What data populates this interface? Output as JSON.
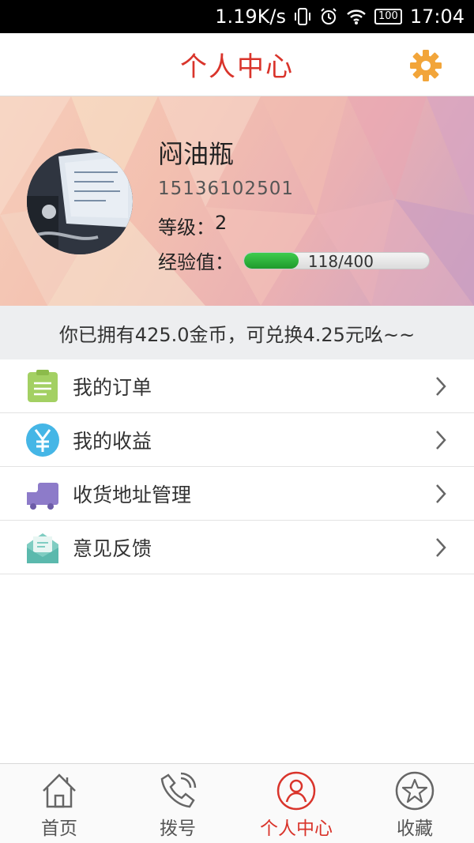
{
  "status_bar": {
    "network_speed": "1.19K/s",
    "battery": "100",
    "time": "17:04"
  },
  "header": {
    "title": "个人中心",
    "settings_icon": "gear-icon"
  },
  "profile": {
    "name": "闷油瓶",
    "phone": "15136102501",
    "level_label": "等级：",
    "level_value": "2",
    "exp_label": "经验值：",
    "exp_text": "118/400",
    "exp_current": 118,
    "exp_max": 400
  },
  "notice": {
    "text": "你已拥有425.0金币，可兑换4.25元吆~~"
  },
  "menu": {
    "items": [
      {
        "label": "我的订单",
        "icon": "clipboard-icon"
      },
      {
        "label": "我的收益",
        "icon": "yen-icon"
      },
      {
        "label": "收货地址管理",
        "icon": "truck-icon"
      },
      {
        "label": "意见反馈",
        "icon": "mail-icon"
      }
    ]
  },
  "bottom_nav": {
    "items": [
      {
        "label": "首页",
        "icon": "home-icon",
        "active": false
      },
      {
        "label": "拨号",
        "icon": "phone-icon",
        "active": false
      },
      {
        "label": "个人中心",
        "icon": "user-icon",
        "active": true
      },
      {
        "label": "收藏",
        "icon": "star-icon",
        "active": false
      }
    ]
  },
  "colors": {
    "accent": "#d9342b",
    "gear": "#f2a53a",
    "progress": "#2aa838"
  }
}
